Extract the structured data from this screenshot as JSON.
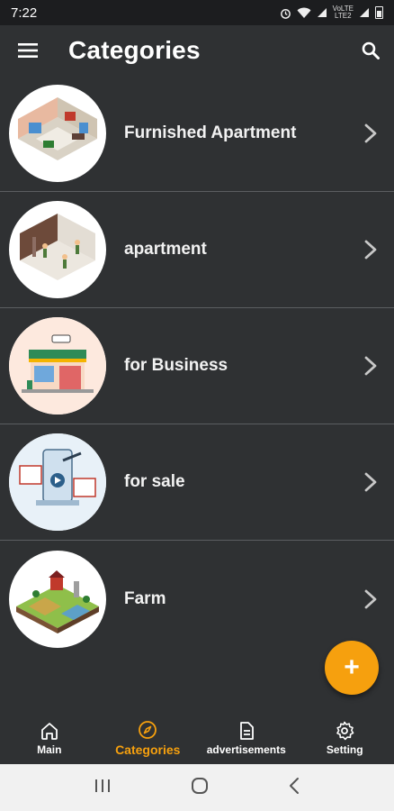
{
  "status_bar": {
    "time": "7:22",
    "network_line1": "VoLTE",
    "network_line2": "LTE2"
  },
  "app_bar": {
    "title": "Categories",
    "menu_icon": "hamburger-menu-icon",
    "search_icon": "search-icon"
  },
  "categories": [
    {
      "label": "Furnished Apartment",
      "image": "furnished-apartment-illustration"
    },
    {
      "label": "apartment",
      "image": "apartment-renovation-illustration"
    },
    {
      "label": "for Business",
      "image": "shop-storefront-illustration"
    },
    {
      "label": "for sale",
      "image": "property-for-sale-illustration"
    },
    {
      "label": "Farm",
      "image": "farm-illustration"
    }
  ],
  "fab": {
    "label": "+"
  },
  "bottom_nav": {
    "items": [
      {
        "label": "Main",
        "icon": "home-icon",
        "active": false
      },
      {
        "label": "Categories",
        "icon": "compass-icon",
        "active": true
      },
      {
        "label": "advertisements",
        "icon": "document-icon",
        "active": false
      },
      {
        "label": "Setting",
        "icon": "gear-icon",
        "active": false
      }
    ]
  },
  "colors": {
    "background": "#2f3133",
    "accent": "#f6a00e",
    "divider": "#5b5e61",
    "status_bar": "#1c1d1f"
  }
}
